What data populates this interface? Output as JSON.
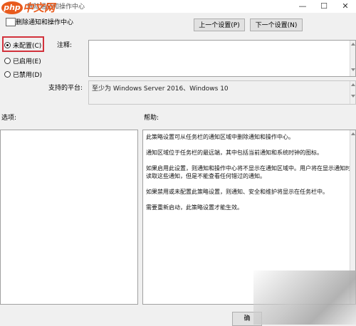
{
  "window": {
    "title": "删除通知和操作中心",
    "minimize_glyph": "—",
    "maximize_glyph": "☐",
    "close_glyph": "✕"
  },
  "watermark": {
    "logo": "php",
    "text": "中文网"
  },
  "policy": {
    "title": "删除通知和操作中心",
    "icon": "policy-icon"
  },
  "nav": {
    "prev_label": "上一个设置(P)",
    "next_label": "下一个设置(N)"
  },
  "options": {
    "selected": "not_configured",
    "items": [
      {
        "key": "not_configured",
        "label": "未配置(C)"
      },
      {
        "key": "enabled",
        "label": "已启用(E)"
      },
      {
        "key": "disabled",
        "label": "已禁用(D)"
      }
    ]
  },
  "comment": {
    "label": "注释:",
    "value": ""
  },
  "supported": {
    "label": "支持的平台:",
    "value": "至少为 Windows Server 2016、Windows 10"
  },
  "options_section": {
    "label": "选项:"
  },
  "help_section": {
    "label": "帮助:",
    "paragraphs": [
      "此策略设置可从任务栏的通知区域中删除通知和操作中心。",
      "通知区域位于任务栏的最远端，其中包括当前通知和系统时钟的图标。",
      "如果启用此设置，则通知和操作中心将不显示在通知区域中。用户将在显示通知时读取这些通知，但是不能查看任何错过的通知。",
      "如果禁用或未配置此策略设置，则通知、安全和维护将显示在任务栏中。",
      "需要重新启动，此策略设置才能生效。"
    ]
  },
  "footer": {
    "button_label": "确"
  }
}
